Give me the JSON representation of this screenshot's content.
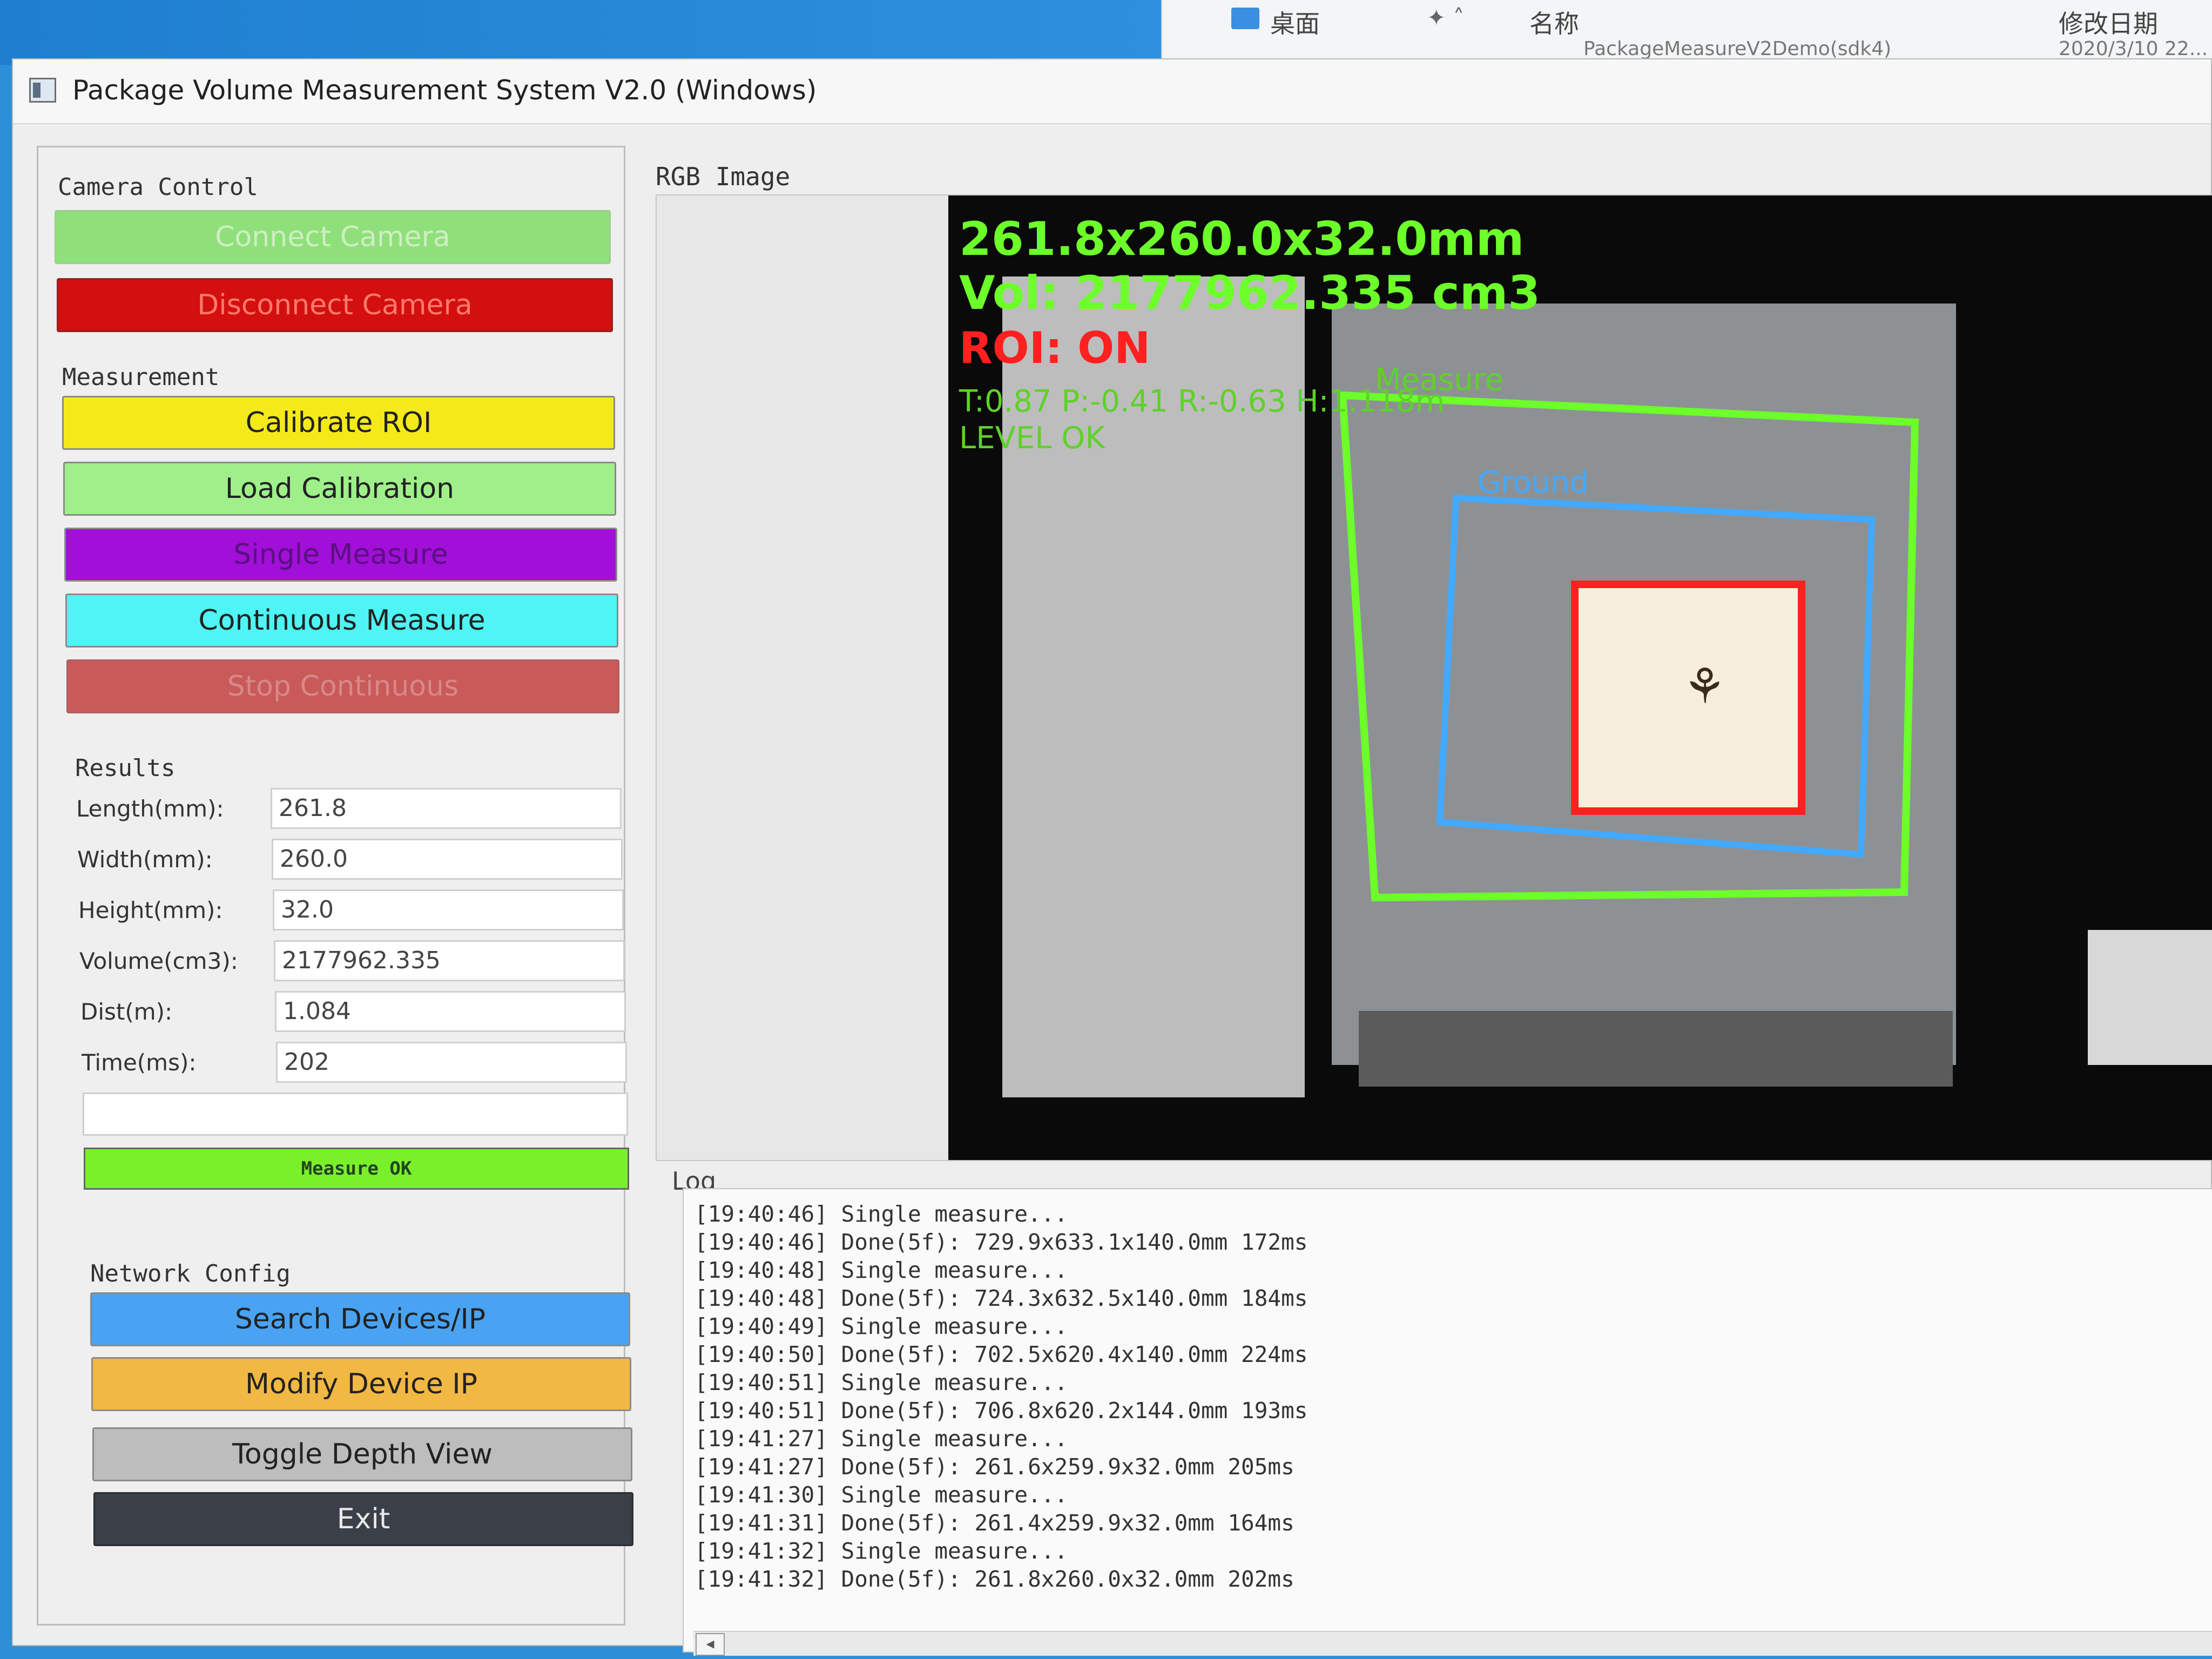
{
  "explorer": {
    "folder_label": "桌面",
    "col_name": "名称",
    "col_modified": "修改日期",
    "row_file": "PackageMeasureV2Demo(sdk4)",
    "row_date": "2020/3/10 22..."
  },
  "window": {
    "title": "Package Volume Measurement System V2.0 (Windows)"
  },
  "camera_control": {
    "label": "Camera Control",
    "connect": "Connect Camera",
    "disconnect": "Disconnect Camera"
  },
  "measurement": {
    "label": "Measurement",
    "calibrate": "Calibrate ROI",
    "load": "Load Calibration",
    "single": "Single Measure",
    "continuous": "Continuous Measure",
    "stop": "Stop Continuous"
  },
  "results": {
    "label": "Results",
    "length_label": "Length(mm):",
    "length": "261.8",
    "width_label": "Width(mm):",
    "width": "260.0",
    "height_label": "Height(mm):",
    "height": "32.0",
    "volume_label": "Volume(cm3):",
    "volume": "2177962.335",
    "dist_label": "Dist(m):",
    "dist": "1.084",
    "time_label": "Time(ms):",
    "time": "202",
    "status": "Measure OK"
  },
  "network": {
    "label": "Network Config",
    "search": "Search Devices/IP",
    "modify": "Modify Device IP",
    "toggle": "Toggle Depth View",
    "exit": "Exit"
  },
  "rgb": {
    "label": "RGB Image",
    "overlay_dims": "261.8x260.0x32.0mm",
    "overlay_vol": "Vol: 2177962.335 cm3",
    "overlay_roi": "ROI: ON",
    "overlay_tilt": "T:0.87 P:-0.41 R:-0.63 H:1.118m",
    "overlay_level": "LEVEL OK",
    "tag_measure": "Measure",
    "tag_ground": "Ground"
  },
  "log": {
    "label": "Log",
    "lines": [
      "[19:40:46] Single measure...",
      "[19:40:46] Done(5f): 729.9x633.1x140.0mm 172ms",
      "[19:40:48] Single measure...",
      "[19:40:48] Done(5f): 724.3x632.5x140.0mm 184ms",
      "[19:40:49] Single measure...",
      "[19:40:50] Done(5f): 702.5x620.4x140.0mm 224ms",
      "[19:40:51] Single measure...",
      "[19:40:51] Done(5f): 706.8x620.2x144.0mm 193ms",
      "[19:41:27] Single measure...",
      "[19:41:27] Done(5f): 261.6x259.9x32.0mm 205ms",
      "[19:41:30] Single measure...",
      "[19:41:31] Done(5f): 261.4x259.9x32.0mm 164ms",
      "[19:41:32] Single measure...",
      "[19:41:32] Done(5f): 261.8x260.0x32.0mm 202ms"
    ]
  },
  "colors": {
    "green_btn": "#8fe07a",
    "red_btn": "#d40f0f",
    "yellow_btn": "#f4ea1a",
    "purple_btn": "#a10fd8",
    "cyan_btn": "#4ff4f4",
    "stop_btn": "#c95a5a",
    "blue_btn": "#4aa3f2",
    "orange_btn": "#f2b844",
    "gray_btn": "#bdbdbd",
    "dark_btn": "#3b3f48",
    "overlay_green": "#6cff2a",
    "overlay_red": "#ff2020",
    "roi_blue": "#43a9ff"
  }
}
